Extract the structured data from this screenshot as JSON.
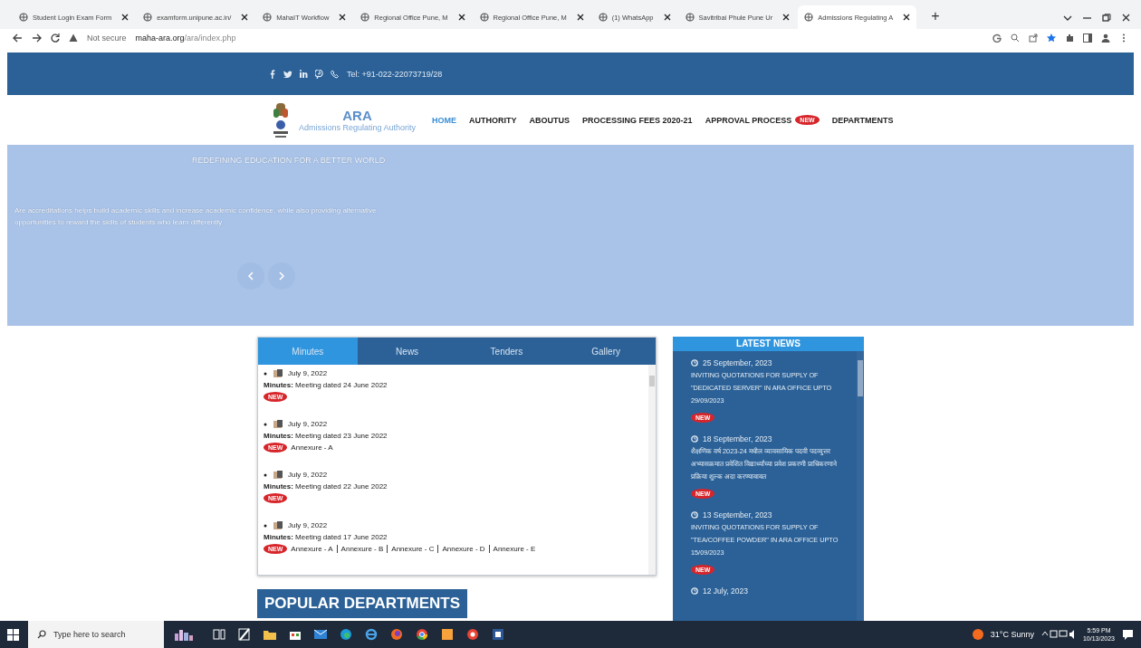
{
  "browser": {
    "tabs": [
      {
        "title": "Student Login Exam Form",
        "selected": false
      },
      {
        "title": "examform.unipune.ac.in/",
        "selected": false
      },
      {
        "title": "MahaIT Workflow",
        "selected": false
      },
      {
        "title": "Regional Office Pune, M",
        "selected": false
      },
      {
        "title": "Regional Office Pune, M",
        "selected": false
      },
      {
        "title": "(1) WhatsApp",
        "selected": false
      },
      {
        "title": "Savitribai Phule Pune Ur",
        "selected": false
      },
      {
        "title": "Admissions Regulating A",
        "selected": true
      }
    ],
    "new_tab": "+",
    "security": "Not secure",
    "url_host": "maha-ara.org",
    "url_path": "/ara/index.php"
  },
  "topbar": {
    "phone": "Tel: +91-022-22073719/28"
  },
  "site": {
    "logo_title": "ARA",
    "logo_subtitle": "Admissions Regulating Authority",
    "nav": [
      {
        "label": "HOME",
        "selected": true
      },
      {
        "label": "AUTHORITY",
        "selected": false
      },
      {
        "label": "ABOUTUS",
        "selected": false
      },
      {
        "label": "PROCESSING FEES 2020-21",
        "selected": false
      },
      {
        "label": "APPROVAL PROCESS",
        "selected": false,
        "badge": "NEW"
      },
      {
        "label": "DEPARTMENTS",
        "selected": false
      }
    ]
  },
  "hero": {
    "title": "REDEFINING EDUCATION FOR A BETTER WORLD",
    "text": "Are accreditations helps build academic skills and increase academic confidence, while also providing alternative opportunities to reward the skills of students who learn differently"
  },
  "tabs": [
    {
      "label": "Minutes",
      "selected": true
    },
    {
      "label": "News",
      "selected": false
    },
    {
      "label": "Tenders",
      "selected": false
    },
    {
      "label": "Gallery",
      "selected": false
    }
  ],
  "minutes": [
    {
      "date": "July 9, 2022",
      "label": "Minutes:",
      "text": "Meeting dated 24 June 2022",
      "badge": "NEW"
    },
    {
      "date": "July 9, 2022",
      "label": "Minutes:",
      "text": "Meeting dated 23 June 2022",
      "badge": "NEW",
      "links": [
        "Annexure - A"
      ]
    },
    {
      "date": "July 9, 2022",
      "label": "Minutes:",
      "text": "Meeting dated 22 June 2022",
      "badge": "NEW"
    },
    {
      "date": "July 9, 2022",
      "label": "Minutes:",
      "text": "Meeting dated 17 June 2022",
      "badge": "NEW",
      "links": [
        "Annexure - A",
        "Annexure - B",
        "Annexure - C",
        "Annexure - D",
        "Annexure - E"
      ]
    }
  ],
  "popular_departments": "POPULAR DEPARTMENTS",
  "latest_news": {
    "title": "LATEST NEWS",
    "items": [
      {
        "date": "25 September, 2023",
        "text": "INVITING QUOTATIONS FOR SUPPLY OF \"DEDICATED SERVER\" IN ARA OFFICE UPTO 29/09/2023",
        "badge": "NEW"
      },
      {
        "date": "18 September, 2023",
        "text": "शैक्षणिक वर्ष 2023-24 मधील व्यावसायिक पदवी पदव्युत्तर अभ्यासक्रमात प्रवेशित विद्यार्थ्यांच्या प्रवेश प्रकरणी प्राधिकरणाने प्रक्रिया शुल्क अदा करण्याबाबत",
        "badge": "NEW"
      },
      {
        "date": "13 September, 2023",
        "text": "INVITING QUOTATIONS FOR SUPPLY OF \"TEA/COFFEE POWDER\" IN ARA OFFICE UPTO 15/09/2023",
        "badge": "NEW"
      },
      {
        "date": "12 July, 2023"
      }
    ]
  },
  "taskbar": {
    "search_placeholder": "Type here to search",
    "weather": "31°C Sunny",
    "time": "5:59 PM",
    "date": "10/13/2023"
  }
}
